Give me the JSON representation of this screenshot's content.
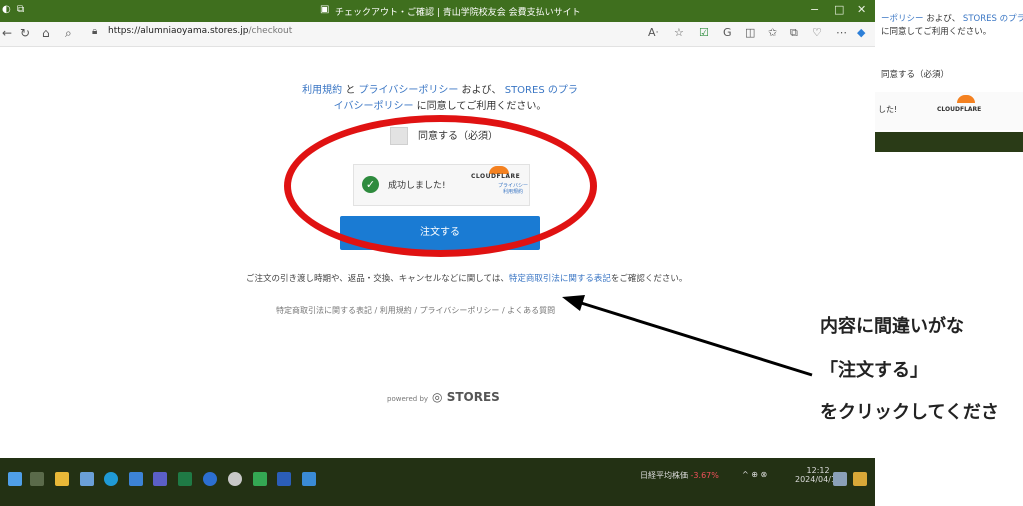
{
  "window": {
    "title": "チェックアウト・ご確認 | 青山学院校友会 会費支払いサイト",
    "icons": [
      "app-icon",
      "tabs-icon",
      "tab-favicon"
    ],
    "controls": [
      "−",
      "□",
      "✕"
    ]
  },
  "addressbar": {
    "url_host": "https://alumniaoyama.stores.jp",
    "url_path": "/checkout",
    "nav_icons": [
      "back-icon",
      "refresh-icon",
      "home-icon",
      "search-icon",
      "lock-icon"
    ],
    "toolbar_icons": [
      "read-aloud-icon",
      "favorite-icon",
      "extension-icon",
      "extension-icon",
      "split-icon",
      "favorites-icon",
      "collections-icon",
      "performance-icon",
      "more-icon",
      "copilot-icon"
    ]
  },
  "page": {
    "policy": {
      "terms_link": "利用規約",
      "and1": "と",
      "privacy_link": "プライバシーポリシー",
      "and2": "および、",
      "stores_privacy_link": "STORES のプライバシーポリシー",
      "suffix": "に同意してご利用ください。"
    },
    "agree_label": "同意する（必須）",
    "turnstile": {
      "status": "成功しました!",
      "brand": "CLOUDFLARE",
      "links": "プライバシー 利用規約"
    },
    "order_button": "注文する",
    "notice": {
      "before": "ご注文の引き渡し時期や、返品・交換、キャンセルなどに関しては、",
      "link": "特定商取引法に関する表記",
      "after": "をご確認ください。"
    },
    "footer_links": "特定商取引法に関する表記 / 利用規約 / プライバシーポリシー / よくある質問",
    "powered_by": "powered by",
    "powered_logo": "STORES"
  },
  "right_fragment": {
    "line1_link": "ーポリシー",
    "line1_rest": " および、",
    "line1_link2": "STORES のプラ",
    "line2": "に同意してご利用ください。",
    "agree": "同意する（必須）",
    "cf_status": "した!",
    "cf_brand": "CLOUDFLARE"
  },
  "instruction": {
    "line1": "内容に間違いがな",
    "line2": "「注文する」",
    "line3": "をクリックしてくださ"
  },
  "taskbar": {
    "stock_name": "日経平均株価",
    "stock_change": "-3.67%",
    "time": "12:12",
    "date": "2024/04/12",
    "icons": [
      "start-icon",
      "task-view-icon",
      "explorer-icon",
      "widgets-icon",
      "edge-icon",
      "store-icon",
      "teams-icon",
      "excel-icon",
      "media-icon",
      "settings-icon",
      "notepad-icon",
      "word-icon",
      "photos-icon"
    ]
  },
  "colors": {
    "title_bar": "#3f6f1e",
    "taskbar": "#233114",
    "order_button": "#1a7bd3",
    "highlight_ellipse": "#e01212",
    "link": "#3a76c4",
    "success": "#2e8b3e"
  }
}
